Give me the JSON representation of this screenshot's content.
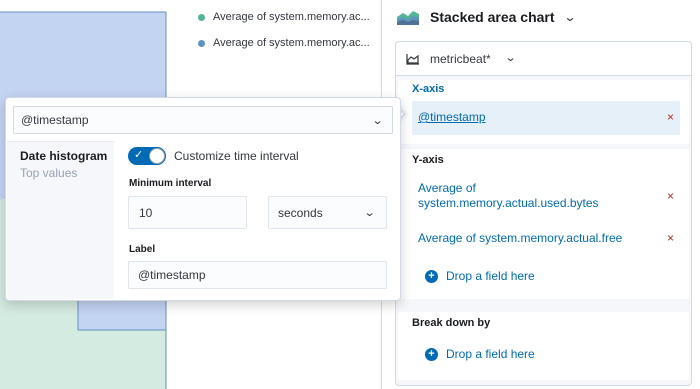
{
  "chart": {
    "legend": [
      {
        "label": "Average of system.memory.ac...",
        "color": "#54b399"
      },
      {
        "label": "Average of system.memory.ac...",
        "color": "#6092c0"
      }
    ],
    "colors": {
      "top_series": "#c3d3f2",
      "bottom_series": "#d4ebe1",
      "top_line": "#6092c0",
      "bottom_line": "#54b399"
    }
  },
  "panel": {
    "vis_type": "Stacked area chart",
    "vis_icon": "stacked-area-chart-icon",
    "data_source": "metricbeat*",
    "x_axis": {
      "label": "X-axis",
      "field": "@timestamp"
    },
    "y_axis": {
      "label": "Y-axis",
      "fields": [
        "Average of system.memory.actual.used.bytes",
        "Average of system.memory.actual.free"
      ],
      "drop_text": "Drop a field here"
    },
    "break_down": {
      "label": "Break down by",
      "drop_text": "Drop a field here"
    },
    "remove_symbol": "×"
  },
  "popover": {
    "field_value": "@timestamp",
    "functions": {
      "selected": "Date histogram",
      "other": "Top values"
    },
    "customize_label": "Customize time interval",
    "customize_enabled": true,
    "min_interval_label": "Minimum interval",
    "interval_value": "10",
    "interval_unit": "seconds",
    "label_label": "Label",
    "label_value": "@timestamp"
  },
  "colors": {
    "accent": "#006bb4",
    "danger": "#bd271e",
    "border": "#d3dae6"
  }
}
